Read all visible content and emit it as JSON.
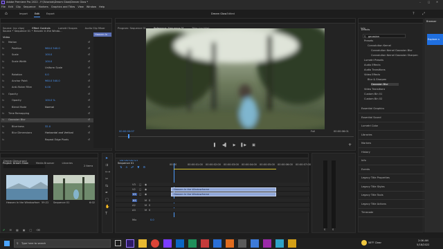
{
  "window": {
    "title": "Adobe Premiere Pro 2022 - F:\\Tutorials\\Dream Glow\\Dream Glow *"
  },
  "menu": [
    "File",
    "Edit",
    "Clip",
    "Sequence",
    "Markers",
    "Graphics and Titles",
    "View",
    "Window",
    "Help"
  ],
  "workspaces": {
    "tabs": [
      "Import",
      "Edit",
      "Export"
    ],
    "active": "Edit",
    "title": "Dream Glow",
    "subtitle": "- Edited"
  },
  "effect_controls": {
    "tabs": [
      "Source: (no clips)",
      "Effect Controls",
      "Lumetri Scopes",
      "Audio Clip Mixer"
    ],
    "active_tab": "Effect Controls",
    "clip_path": "Source • Sequence 01 • Heaven In the Windo...",
    "mini_clip": "Heaven In",
    "section": "Video",
    "rows": [
      {
        "label": "Motion",
        "value": ""
      },
      {
        "label": "Position",
        "value": "960.0   540.0"
      },
      {
        "label": "Scale",
        "value": "100.0"
      },
      {
        "label": "Scale Width",
        "value": "100.0"
      },
      {
        "label": "",
        "value": "Uniform Scale"
      },
      {
        "label": "Rotation",
        "value": "0.0"
      },
      {
        "label": "Anchor Point",
        "value": "960.0   540.0"
      },
      {
        "label": "Anti-flicker Filter",
        "value": "0.00"
      },
      {
        "label": "Opacity",
        "value": ""
      },
      {
        "label": "Opacity",
        "value": "100.0 %"
      },
      {
        "label": "Blend Mode",
        "value": "Normal"
      },
      {
        "label": "Time Remapping",
        "value": ""
      },
      {
        "label": "Gaussian Blur",
        "value": ""
      },
      {
        "label": "Blurriness",
        "value": "32.0"
      },
      {
        "label": "Blur Dimensions",
        "value": "Horizontal and Vertical"
      },
      {
        "label": "",
        "value": "Repeat Edge Pixels"
      }
    ],
    "timecode": "00:00:00:07"
  },
  "program": {
    "tabs": [
      "Program: Sequence 01",
      "Reference: Sequence 01",
      "Title: (no title)"
    ],
    "timecode_left": "00:00:00:07",
    "fit": "Full",
    "timecode_right": "00:00:06:01"
  },
  "project": {
    "tabs": [
      "Project: Dream Glow",
      "Media Browser",
      "Libraries"
    ],
    "file": "Dream Glow.prproj",
    "item_count": "2 Items",
    "items": [
      {
        "name": "Heaven In the Windowframe",
        "duration": "59:22"
      },
      {
        "name": "Sequence 01",
        "duration": "6:02"
      }
    ]
  },
  "timeline": {
    "tab": "Sequence 01",
    "timecode": "00:00:00:07",
    "ruler": [
      "00:00",
      "00:00:01:00",
      "00:00:02:00",
      "00:00:03:00",
      "00:00:04:00",
      "00:00:05:00",
      "00:00:06:00",
      "00:00:07:00"
    ],
    "video_tracks": [
      "V3",
      "V2",
      "V1"
    ],
    "audio_tracks": [
      "A1",
      "A2",
      "A3"
    ],
    "mix": "Mix",
    "mix_value": "0.0",
    "clips": {
      "video": "Heaven In the Windowframe",
      "audio": "Heaven In the Windowframe"
    }
  },
  "effects": {
    "tab": "Effects",
    "search": "gaussian",
    "tree": [
      "Presets",
      "Convolution Kernel",
      "Convolution Kernel Gaussian Blur",
      "Convolution Kernel Gaussian Sharpen",
      "Lumetri Presets",
      "Audio Effects",
      "Audio Transitions",
      "Video Effects",
      "Blur & Sharpen",
      "Gaussian Blur",
      "Video Transitions",
      "Custom Bin 01",
      "Custom Bin 02"
    ],
    "panels": [
      "Essential Graphics",
      "Essential Sound",
      "Lumetri Color",
      "Libraries",
      "Markers",
      "History",
      "Info",
      "Events",
      "Legacy Title Properties",
      "Legacy Title Styles",
      "Legacy Title Tools",
      "Legacy Title Actions",
      "Timecode"
    ]
  },
  "browser": {
    "tab": "Browser",
    "text": "Explore n"
  },
  "taskbar": {
    "search": "Type here to search",
    "weather": "58°F Clear",
    "time": "2:06 AM",
    "date": "5/18/2022"
  }
}
